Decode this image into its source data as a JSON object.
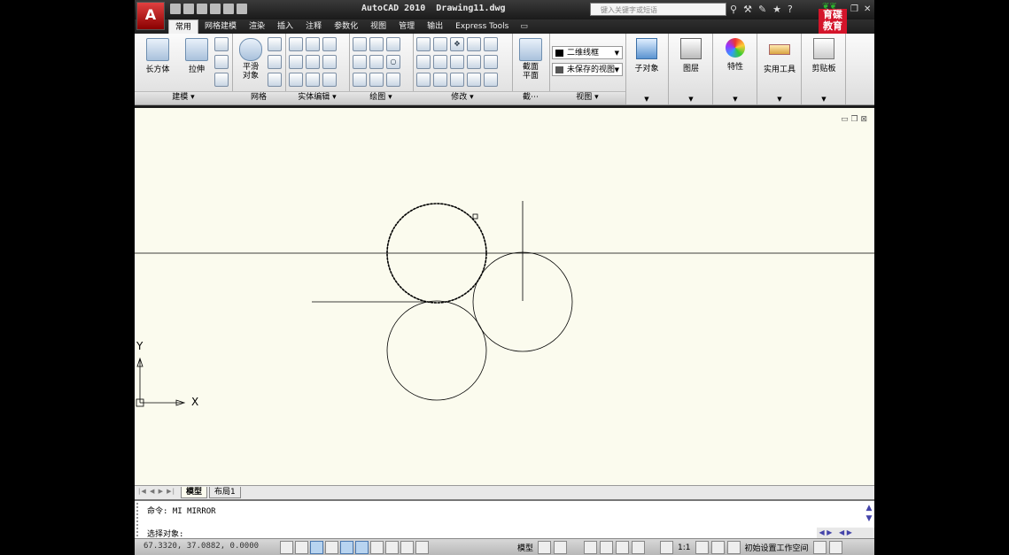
{
  "app": {
    "title": "AutoCAD 2010  Drawing11.dwg",
    "search_placeholder": "键入关键字或短语",
    "logo_letter": "A",
    "brand_text": "育碟\n教育"
  },
  "tabs": [
    "常用",
    "网格建模",
    "渲染",
    "插入",
    "注释",
    "参数化",
    "视图",
    "管理",
    "输出",
    "Express Tools"
  ],
  "ribbon": {
    "modeling": {
      "box_label": "长方体",
      "extrude_label": "拉伸",
      "footer": "建模 ▾"
    },
    "mesh": {
      "smooth_label": "平滑\n对象",
      "footer": "网格"
    },
    "solid_edit": {
      "footer": "实体编辑 ▾"
    },
    "draw": {
      "footer": "绘图 ▾"
    },
    "modify": {
      "footer": "修改 ▾"
    },
    "section": {
      "label": "截面\n平面",
      "footer": "截⋯"
    },
    "view": {
      "visual_style": "二维线框",
      "saved_view": "未保存的视图",
      "footer": "视图 ▾"
    },
    "right_buttons": [
      "子对象",
      "图层",
      "特性",
      "实用工具",
      "剪贴板"
    ]
  },
  "drawing": {
    "ucs_x": "X",
    "ucs_y": "Y"
  },
  "layout_tabs": {
    "model": "模型",
    "layout1": "布局1"
  },
  "command": {
    "history": "命令: MI MIRROR",
    "prompt": "选择对象:"
  },
  "status": {
    "coords": "67.3320,  37.0882, 0.0000",
    "model_label": "模型",
    "scale_label": "1:1",
    "workspace": "初始设置工作空间"
  }
}
